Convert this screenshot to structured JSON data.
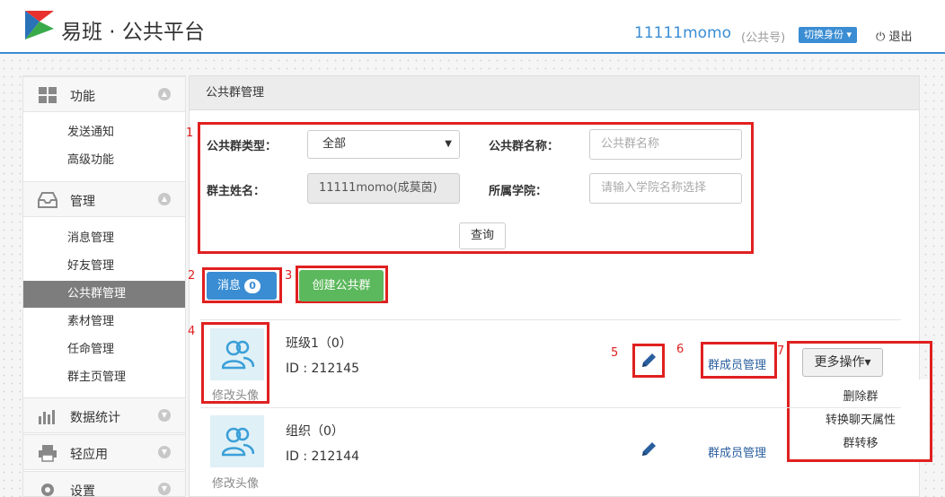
{
  "header": {
    "brand": "易班 · 公共平台",
    "account_name": "11111momo",
    "account_type": "(公共号)",
    "switch_label": "切换身份 ▾",
    "logout_label": "退出"
  },
  "sidebar": {
    "sections": [
      {
        "label": "功能",
        "items": [
          "发送通知",
          "高级功能"
        ]
      },
      {
        "label": "管理",
        "items": [
          "消息管理",
          "好友管理",
          "公共群管理",
          "素材管理",
          "任命管理",
          "群主页管理"
        ]
      },
      {
        "label": "数据统计"
      },
      {
        "label": "轻应用"
      },
      {
        "label": "设置"
      }
    ],
    "active_item": "公共群管理"
  },
  "panel": {
    "title": "公共群管理"
  },
  "filter": {
    "group_type_label": "公共群类型：",
    "group_type_value": "全部",
    "group_name_label": "公共群名称：",
    "group_name_placeholder": "公共群名称",
    "owner_label": "群主姓名：",
    "owner_value": "11111momo(成莫茵)",
    "college_label": "所属学院：",
    "college_placeholder": "请输入学院名称选择",
    "query_label": "查询"
  },
  "actions": {
    "message_label": "消息",
    "message_count": "0",
    "create_label": "创建公共群"
  },
  "groups": [
    {
      "name": "班级1（0）",
      "id": "ID : 212145",
      "avatar_caption": "修改头像",
      "members_link": "群成员管理",
      "more_label": "更多操作▾"
    },
    {
      "name": "组织（0）",
      "id": "ID : 212144",
      "avatar_caption": "修改头像",
      "members_link": "群成员管理"
    }
  ],
  "more_menu": [
    "删除群",
    "转换聊天属性",
    "群转移"
  ],
  "annotations": [
    "1",
    "2",
    "3",
    "4",
    "5",
    "6",
    "7"
  ],
  "colors": {
    "accent": "#3a8dd3",
    "highlight": "#e02020",
    "success": "#5cb85c",
    "active_nav": "#7d7d7d"
  }
}
